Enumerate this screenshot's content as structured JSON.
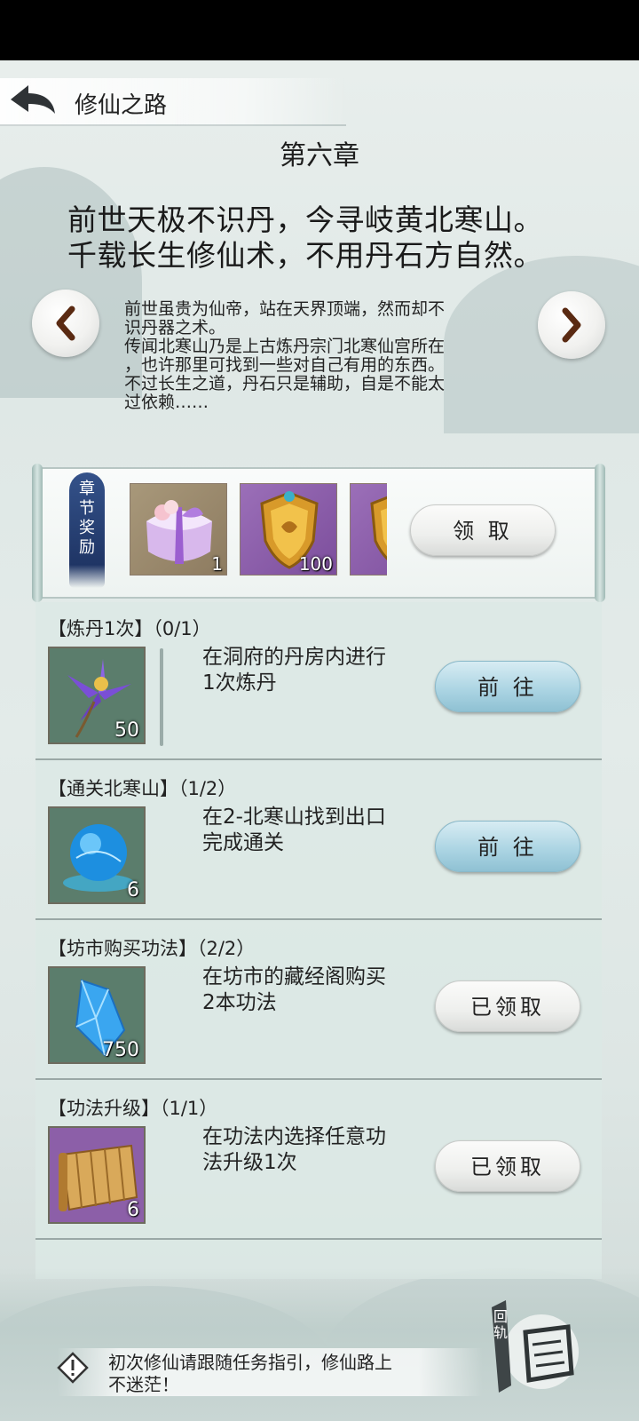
{
  "header": {
    "title": "修仙之路",
    "back_icon": "back-arrow-icon"
  },
  "chapter": {
    "title": "第六章",
    "poem": "前世天极不识丹，今寻岐黄北寒山。\n千载长生修仙术，不用丹石方自然。",
    "story": "前世虽贵为仙帝，站在天界顶端，然而却不\n识丹器之术。\n传闻北寒山乃是上古炼丹宗门北寒仙宫所在\n，也许那里可找到一些对自己有用的东西。\n不过长生之道，丹石只是辅助，自是不能太\n过依赖……",
    "prev_icon": "chevron-left-icon",
    "next_icon": "chevron-right-icon"
  },
  "rewards": {
    "tag": [
      "章",
      "节",
      "奖",
      "励"
    ],
    "items": [
      {
        "icon": "gift-box-icon",
        "count": "1"
      },
      {
        "icon": "golden-shield-icon",
        "count": "100"
      },
      {
        "icon": "golden-shield-icon",
        "count": ""
      }
    ],
    "claim_label": "领 取"
  },
  "tasks": [
    {
      "title": "【炼丹1次】（0/1）",
      "icon": "purple-flower-icon",
      "count": "50",
      "desc": "在洞府的丹房内进行1次炼丹",
      "button": "前 往",
      "state": "go"
    },
    {
      "title": "【通关北寒山】（1/2）",
      "icon": "blue-orb-icon",
      "count": "6",
      "desc": "在2-北寒山找到出口完成通关",
      "button": "前 往",
      "state": "go"
    },
    {
      "title": "【坊市购买功法】（2/2）",
      "icon": "blue-crystal-icon",
      "count": "750",
      "desc": "在坊市的藏经阁购买2本功法",
      "button": "已领取",
      "state": "claimed"
    },
    {
      "title": "【功法升级】（1/1）",
      "icon": "bamboo-scroll-icon",
      "count": "6",
      "desc": "在功法内选择任意功法升级1次",
      "button": "已领取",
      "state": "claimed"
    }
  ],
  "footer": {
    "hint": "初次修仙请跟随任务指引，修仙路上\n不迷茫！",
    "hint_icon": "warning-diamond-icon",
    "return_label": "回\n轨",
    "return_icon": "scroll-icon"
  },
  "colors": {
    "go_button": "#a9d3e2",
    "claimed_button": "#eeefed",
    "reward_tag": "#2a4378",
    "panel": "#dce8e5"
  }
}
